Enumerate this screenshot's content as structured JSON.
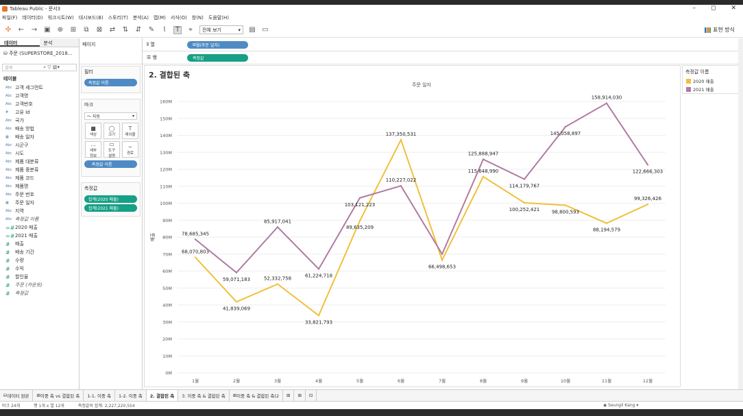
{
  "app": {
    "title": "Tableau Public - 문서3"
  },
  "menu": [
    "파일(F)",
    "데이터(D)",
    "워크시트(W)",
    "대시보드(B)",
    "스토리(T)",
    "분석(A)",
    "맵(M)",
    "서식(O)",
    "창(N)",
    "도움말(H)"
  ],
  "toolbar": {
    "view_select": "전체 보기",
    "present_label": "표현 방식"
  },
  "datapane": {
    "tabs": [
      "데이터",
      "분석"
    ],
    "source": "주문 (SUPERSTORE_2018...",
    "search_placeholder": "검색",
    "tables_label": "테이블",
    "fields": [
      {
        "type": "Abc",
        "name": "고객 세그먼트"
      },
      {
        "type": "Abc",
        "name": "고객명"
      },
      {
        "type": "Abc",
        "name": "고객번호"
      },
      {
        "type": "#",
        "name": "고유 Id"
      },
      {
        "type": "Abc",
        "name": "국가"
      },
      {
        "type": "Abc",
        "name": "배송 방법"
      },
      {
        "type": "▦",
        "name": "배송 일자"
      },
      {
        "type": "Abc",
        "name": "시군구"
      },
      {
        "type": "Abc",
        "name": "시도"
      },
      {
        "type": "Abc",
        "name": "제품 대분류"
      },
      {
        "type": "Abc",
        "name": "제품 중분류"
      },
      {
        "type": "Abc",
        "name": "제품 코드"
      },
      {
        "type": "Abc",
        "name": "제품명"
      },
      {
        "type": "Abc",
        "name": "주문 번호"
      },
      {
        "type": "▦",
        "name": "주문 일자"
      },
      {
        "type": "Abc",
        "name": "지역"
      },
      {
        "type": "Abc",
        "name": "측정값 이름",
        "italic": true
      },
      {
        "type": "=#",
        "name": "2020 매출",
        "measure": true
      },
      {
        "type": "=#",
        "name": "2021 매출",
        "measure": true
      },
      {
        "type": "#",
        "name": "매출",
        "measure": true
      },
      {
        "type": "#",
        "name": "배송 기간",
        "measure": true
      },
      {
        "type": "#",
        "name": "수량",
        "measure": true
      },
      {
        "type": "#",
        "name": "수익",
        "measure": true
      },
      {
        "type": "#",
        "name": "할인율",
        "measure": true
      },
      {
        "type": "#",
        "name": "주문 (카운트)",
        "measure": true,
        "italic": true
      },
      {
        "type": "#",
        "name": "측정값",
        "measure": true,
        "italic": true
      }
    ]
  },
  "cards": {
    "pages_label": "페이지",
    "filters_label": "필터",
    "filter_pill": "측정값 이름",
    "marks_label": "마크",
    "mark_type": "자동",
    "mark_buttons": [
      {
        "icon": "■",
        "label": "색상"
      },
      {
        "icon": "◯",
        "label": "크기"
      },
      {
        "icon": "T",
        "label": "레이블"
      },
      {
        "icon": "…",
        "label": "세부\n정보"
      },
      {
        "icon": "▭",
        "label": "도구\n설명"
      },
      {
        "icon": "~",
        "label": "경로"
      }
    ],
    "color_pill": "측정값 이름",
    "measures_label": "측정값",
    "measure_pills": [
      "합계(2020 매출)",
      "합계(2021 매출)"
    ]
  },
  "shelves": {
    "columns_label": "열",
    "columns_pill": "월(주문 일자)",
    "rows_label": "행",
    "rows_pill": "측정값"
  },
  "sheet": {
    "title": "2. 결합된 축"
  },
  "legend": {
    "title": "측정값 이름",
    "items": [
      {
        "name": "2020 매출",
        "color": "#f0c038"
      },
      {
        "name": "2021 매출",
        "color": "#b07aa1"
      }
    ]
  },
  "chart_data": {
    "type": "line",
    "title": "",
    "header": "주문 일자",
    "xlabel": "",
    "ylabel": "매출",
    "categories": [
      "1월",
      "2월",
      "3월",
      "4월",
      "5월",
      "6월",
      "7월",
      "8월",
      "9월",
      "10월",
      "11월",
      "12월"
    ],
    "ylim": [
      0,
      160000000
    ],
    "yticks": [
      "0M",
      "10M",
      "20M",
      "30M",
      "40M",
      "50M",
      "60M",
      "70M",
      "80M",
      "90M",
      "100M",
      "110M",
      "120M",
      "130M",
      "140M",
      "150M",
      "160M"
    ],
    "series": [
      {
        "name": "2020 매출",
        "color": "#f0c038",
        "values": [
          68070803,
          41839069,
          52332758,
          33821793,
          89635209,
          137350531,
          66498653,
          115648990,
          100252421,
          98800593,
          88194579,
          99326426
        ],
        "labels": [
          "68,070,803",
          "41,839,069",
          "52,332,758",
          "33,821,793",
          "89,635,209",
          "137,350,531",
          "66,498,653",
          "115,648,990",
          "100,252,421",
          "98,800,593",
          "88,194,579",
          "99,326,426"
        ]
      },
      {
        "name": "2021 매출",
        "color": "#b07aa1",
        "values": [
          78685345,
          59071183,
          85917041,
          61224718,
          103121223,
          110227022,
          70000000,
          125888947,
          114179767,
          145058897,
          158914030,
          122666303
        ],
        "labels": [
          "78,685,345",
          "59,071,183",
          "85,917,041",
          "61,224,718",
          "103,121,223",
          "110,227,022",
          "",
          "125,888,947",
          "114,179,767",
          "145,058,897",
          "158,914,030",
          "122,666,303"
        ]
      }
    ],
    "grid": true,
    "legend": "right"
  },
  "sheet_tabs": [
    "데이터 원본",
    "이중 축 vs 결합된 축",
    "1-1. 이중 축",
    "1-2. 이중 축",
    "2. 결합된 축",
    "3. 이중 축 & 결합된 축",
    "이중 축 & 결합된 축(2"
  ],
  "status": {
    "marks": "마크 24개",
    "rowscols": "행 1개 x 열 12개",
    "sum": "측정값의 합계: 2,227,220,554",
    "user": "Seungil Kang"
  }
}
